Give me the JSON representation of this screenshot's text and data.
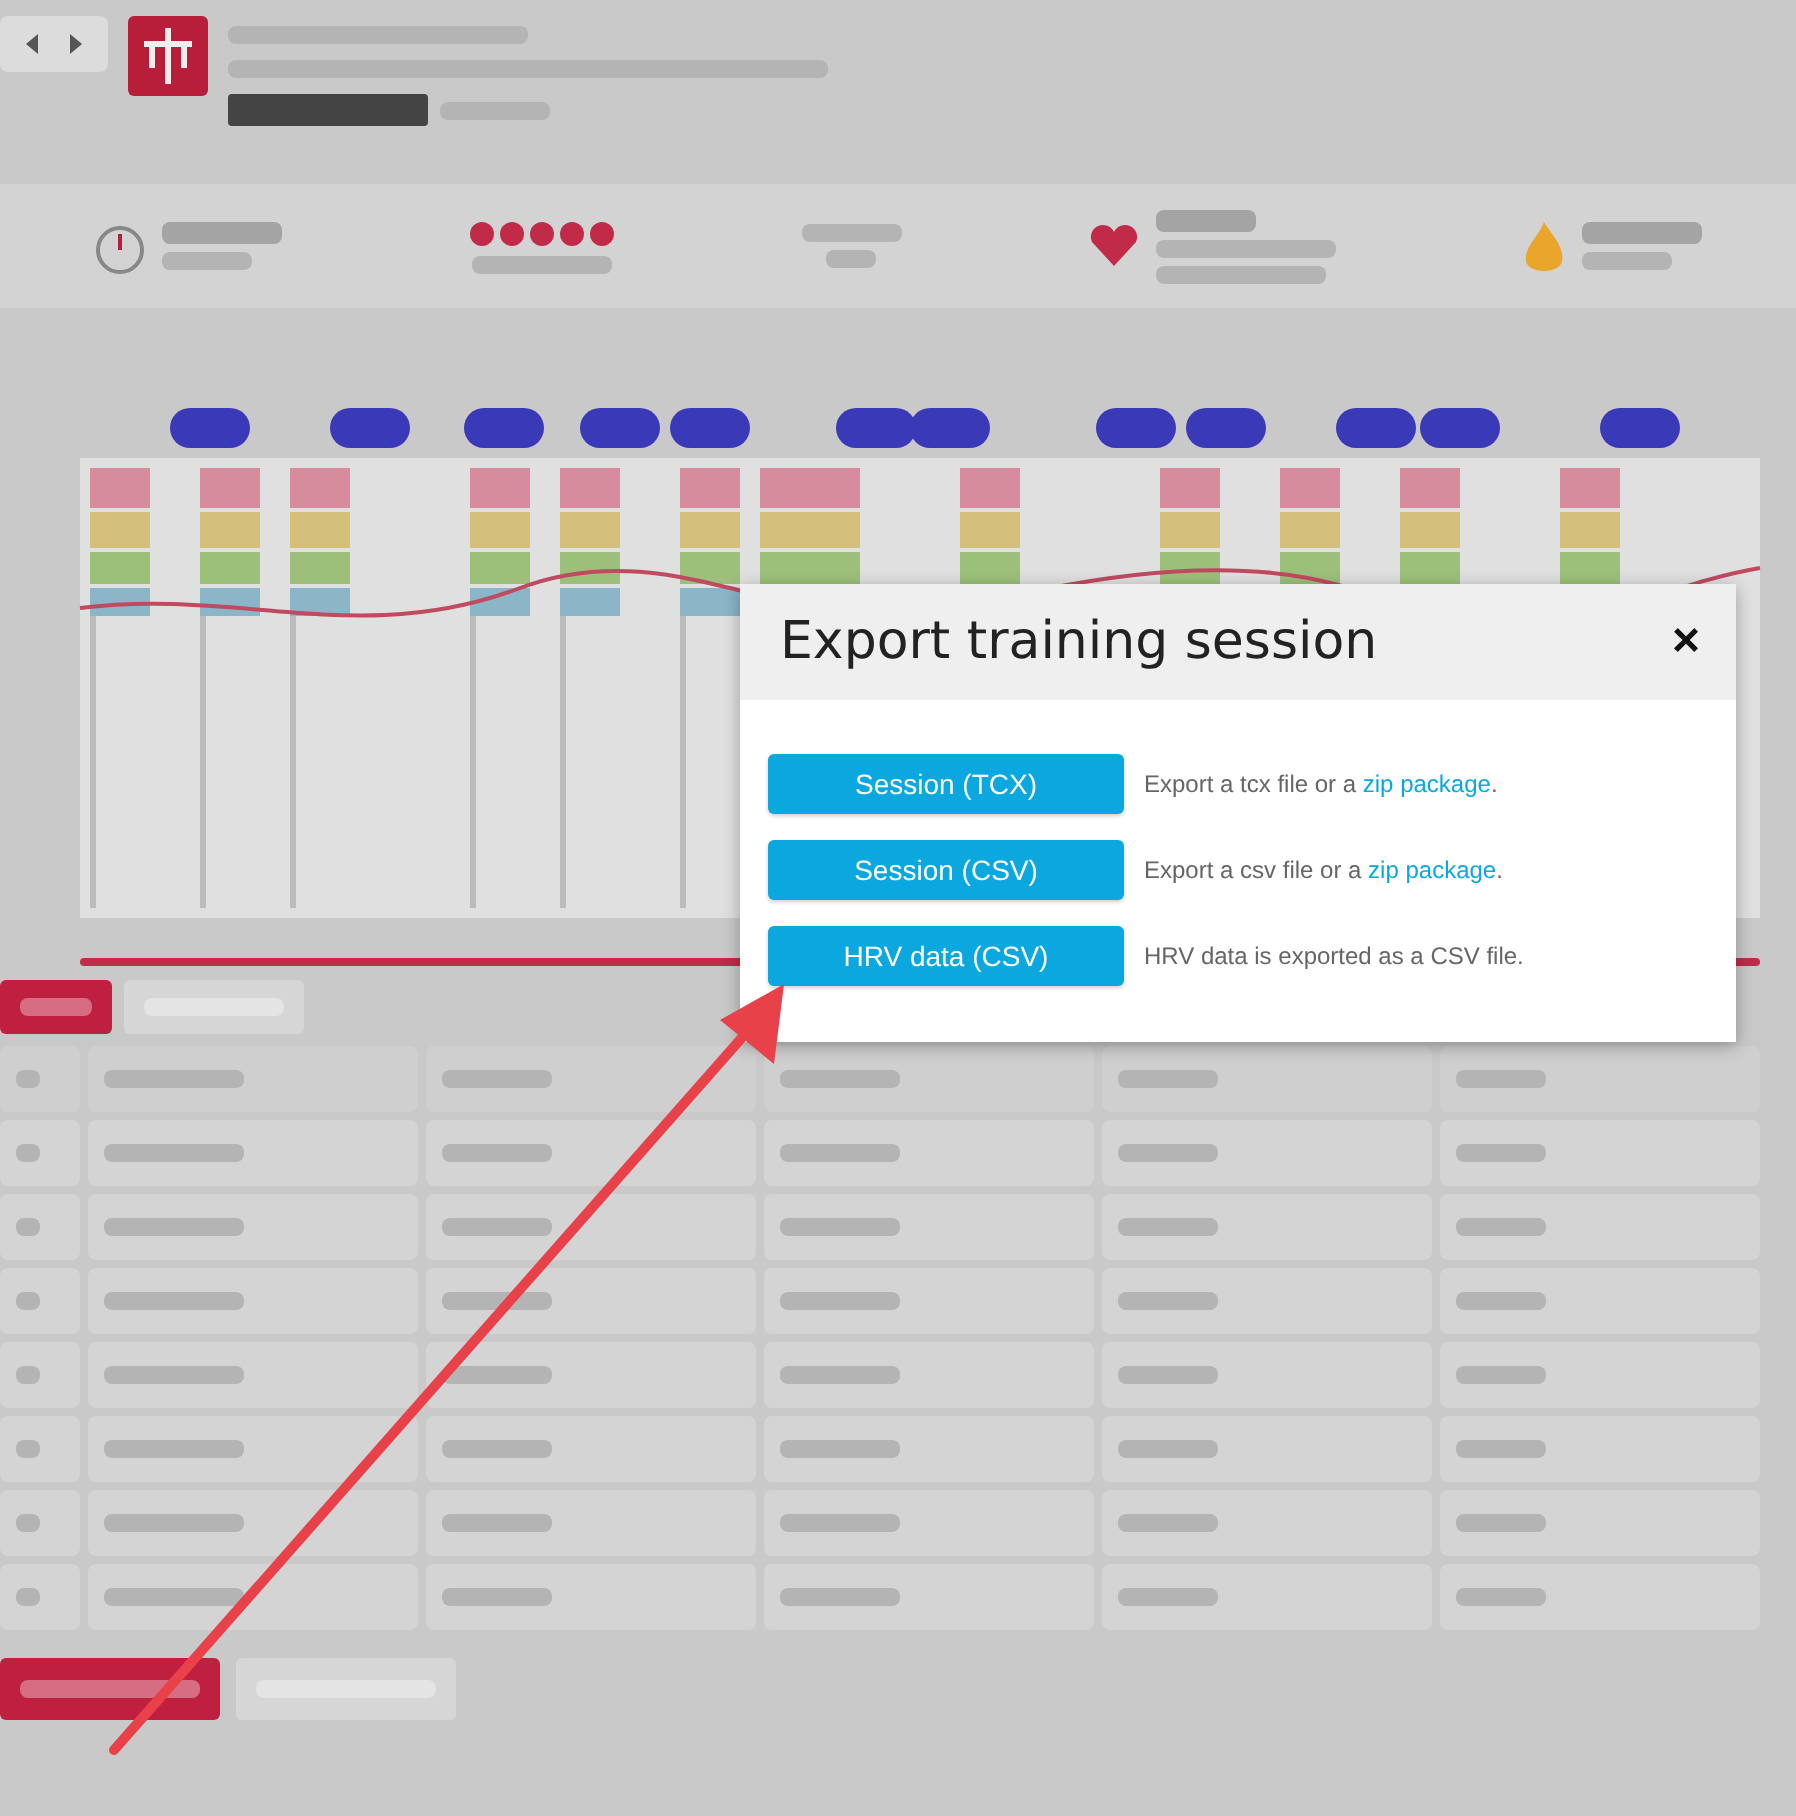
{
  "tabs": [
    {
      "selected": true
    },
    {
      "selected": false
    }
  ],
  "actions": [
    {
      "primary": true
    },
    {
      "primary": false
    }
  ],
  "dialog": {
    "title": "Export training session",
    "close": "×",
    "items": [
      {
        "button": "Session (TCX)",
        "text": "Export a tcx file or a ",
        "link": "zip package",
        "after": "."
      },
      {
        "button": "Session (CSV)",
        "text": "Export a csv file or a ",
        "link": "zip package",
        "after": "."
      },
      {
        "button": "HRV data (CSV)",
        "text": "HRV data is exported as a CSV file."
      }
    ]
  }
}
